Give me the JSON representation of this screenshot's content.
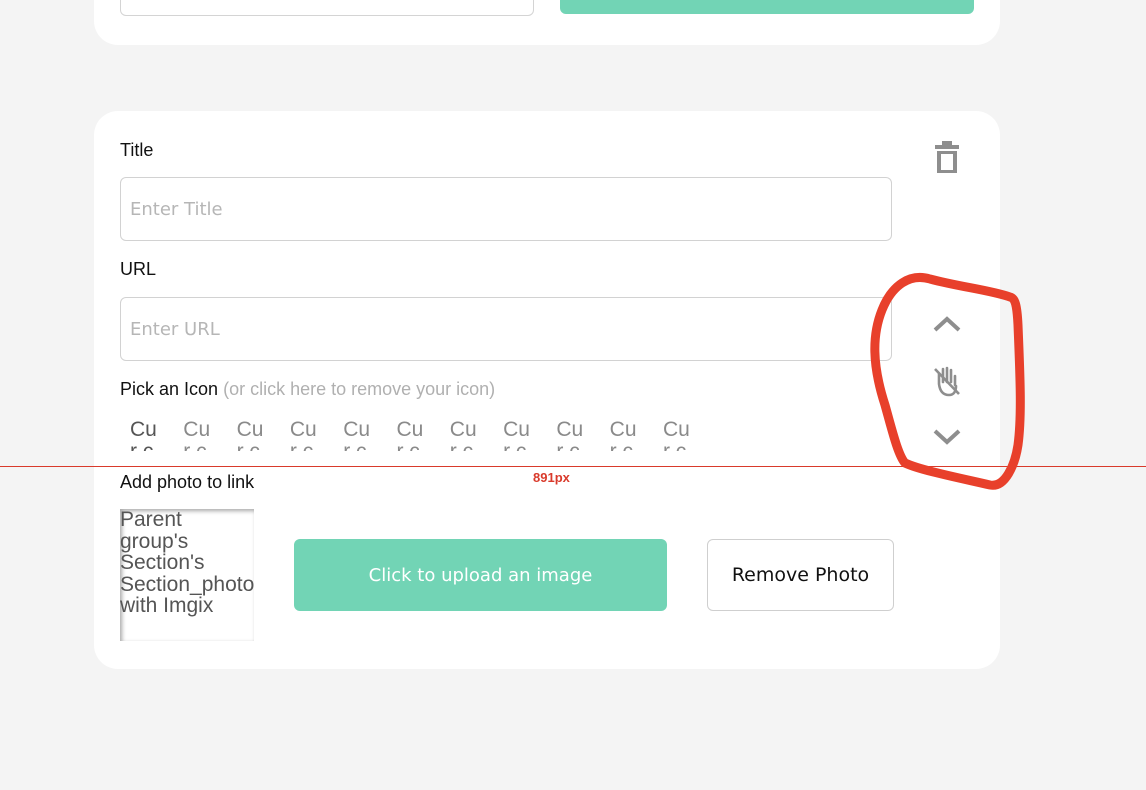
{
  "title_field": {
    "label": "Title",
    "placeholder": "Enter Title"
  },
  "url_field": {
    "label": "URL",
    "placeholder": "Enter URL"
  },
  "icon_picker": {
    "label": "Pick an Icon",
    "hint": "(or click here to remove your icon)",
    "cells": [
      "Cur coll",
      "Cur coll",
      "Cur coll",
      "Cur coll",
      "Cur coll",
      "Cur coll",
      "Cur coll",
      "Cur coll",
      "Cur coll",
      "Cur coll",
      "Cur coll"
    ]
  },
  "photo": {
    "label": "Add photo to link",
    "placeholder_alt": "Parent group's Section's Section_photo with Imgix",
    "upload_label": "Click to upload an image",
    "remove_label": "Remove Photo"
  },
  "side_controls": {
    "icons": [
      "trash-icon",
      "chevron-up-icon",
      "drag-hand-icon",
      "chevron-down-icon"
    ]
  },
  "overlay": {
    "ruler_label": "891px",
    "ruler_color": "#d93a2b",
    "annotation_color": "#e8402b"
  },
  "colors": {
    "accent": "#72d4b5",
    "background": "#f4f4f4",
    "card": "#ffffff"
  }
}
